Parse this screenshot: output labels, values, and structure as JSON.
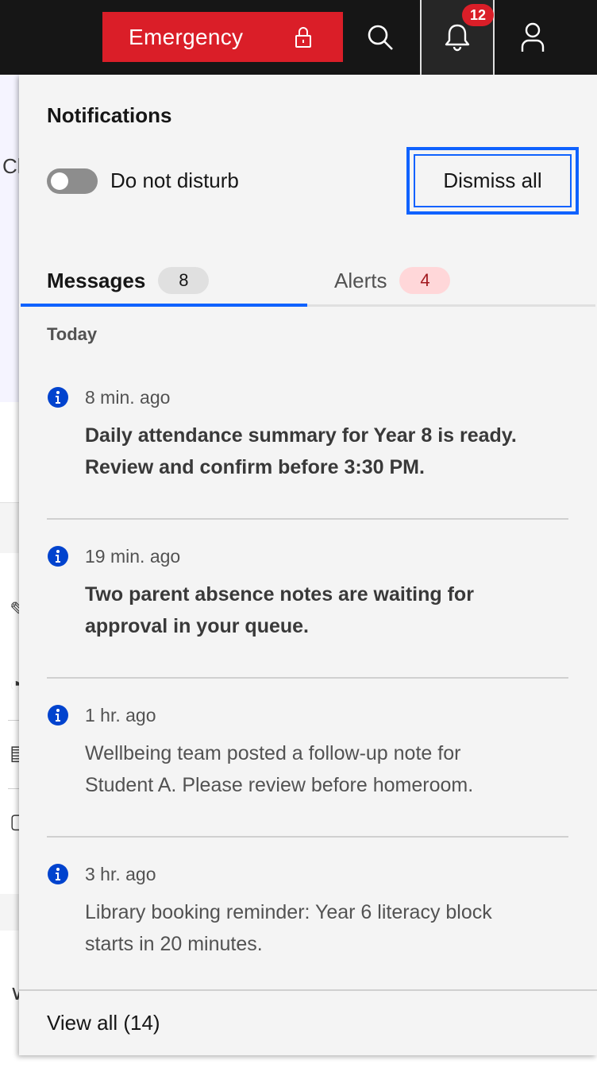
{
  "header": {
    "emergency_label": "Emergency",
    "notification_count": "12",
    "icons": [
      "lock-icon",
      "search-icon",
      "bell-icon",
      "user-icon"
    ]
  },
  "background": {
    "hero_text": "Cl"
  },
  "panel": {
    "title": "Notifications",
    "dnd_label": "Do not disturb",
    "dnd_enabled": false,
    "dismiss_label": "Dismiss all",
    "tabs": [
      {
        "label": "Messages",
        "count": "8",
        "active": true
      },
      {
        "label": "Alerts",
        "count": "4",
        "active": false
      }
    ],
    "section": "Today",
    "items": [
      {
        "time": "8 min. ago",
        "line1": "Daily attendance summary for Year 8 is ready.",
        "line2": "Review and confirm before 3:30 PM.",
        "unread": true
      },
      {
        "time": "19 min. ago",
        "line1": "Two parent absence notes are waiting for",
        "line2": "approval in your queue.",
        "unread": true
      },
      {
        "time": "1 hr. ago",
        "line1": "Wellbeing team posted a follow-up note for",
        "line2": "Student A. Please review before homeroom.",
        "unread": false
      },
      {
        "time": "3 hr. ago",
        "line1": "Library booking reminder: Year 6 literacy block",
        "line2": "starts in 20 minutes.",
        "unread": false
      }
    ],
    "view_all_label": "View all (14)"
  },
  "colors": {
    "header_bg": "#161616",
    "emergency": "#da1e28",
    "accent": "#0f62fe",
    "panel_bg": "#f4f4f4"
  }
}
